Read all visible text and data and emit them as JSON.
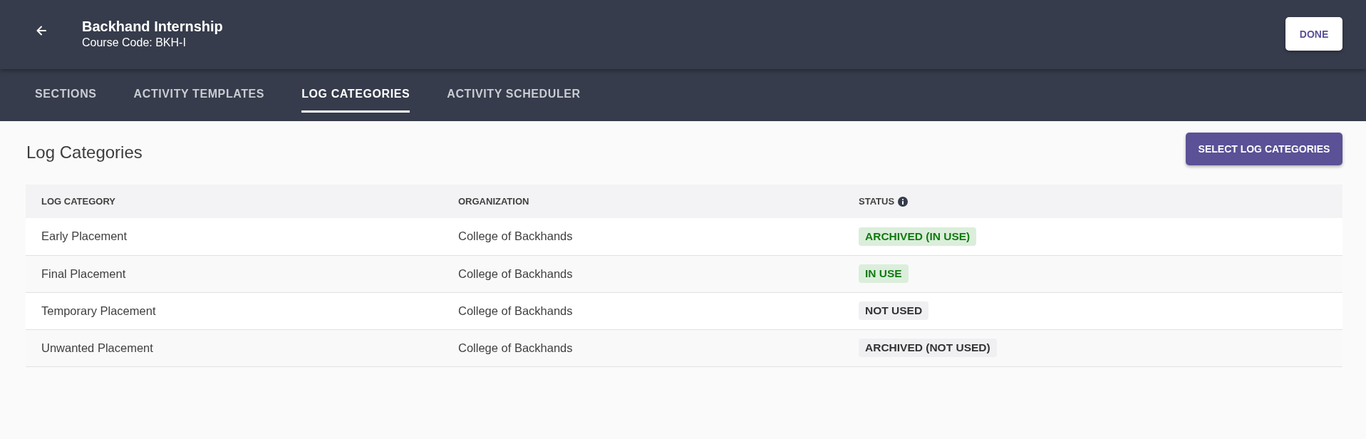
{
  "header": {
    "title": "Backhand Internship",
    "subtitle": "Course Code: BKH-I",
    "done_button": "DONE"
  },
  "tabs": [
    {
      "label": "SECTIONS",
      "selected": false
    },
    {
      "label": "ACTIVITY TEMPLATES",
      "selected": false
    },
    {
      "label": "LOG CATEGORIES",
      "selected": true
    },
    {
      "label": "ACTIVITY SCHEDULER",
      "selected": false
    }
  ],
  "page": {
    "heading": "Log Categories",
    "select_button": "SELECT LOG CATEGORIES"
  },
  "table": {
    "columns": [
      {
        "label": "LOG CATEGORY",
        "has_info": false
      },
      {
        "label": "ORGANIZATION",
        "has_info": false
      },
      {
        "label": "STATUS",
        "has_info": true
      }
    ],
    "rows": [
      {
        "log_category": "Early Placement",
        "organization": "College of Backhands",
        "status": {
          "label": "ARCHIVED (IN USE)",
          "kind": "in-use"
        }
      },
      {
        "log_category": "Final Placement",
        "organization": "College of Backhands",
        "status": {
          "label": "IN USE",
          "kind": "in-use"
        }
      },
      {
        "log_category": "Temporary Placement",
        "organization": "College of Backhands",
        "status": {
          "label": "NOT USED",
          "kind": "not-used"
        }
      },
      {
        "log_category": "Unwanted Placement",
        "organization": "College of Backhands",
        "status": {
          "label": "ARCHIVED (NOT USED)",
          "kind": "not-used"
        }
      }
    ]
  }
}
